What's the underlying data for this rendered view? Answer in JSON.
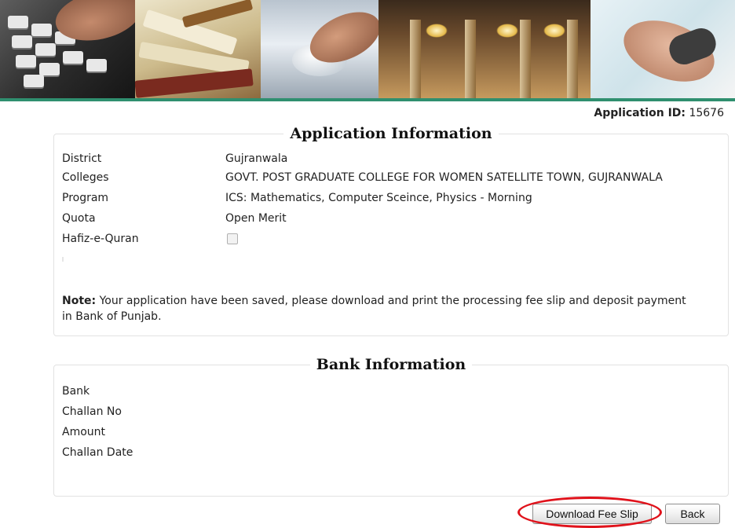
{
  "header": {
    "app_id_label": "Application ID:",
    "app_id_value": "15676"
  },
  "application_info": {
    "title": "Application Information",
    "fields": [
      {
        "label": "District",
        "value": "Gujranwala"
      },
      {
        "label": "Colleges",
        "value": "GOVT. POST GRADUATE COLLEGE FOR WOMEN SATELLITE TOWN, GUJRANWALA"
      },
      {
        "label": "Program",
        "value": "ICS: Mathematics, Computer Sceince, Physics - Morning"
      },
      {
        "label": "Quota",
        "value": "Open Merit"
      },
      {
        "label": "Hafiz-e-Quran",
        "checked": false
      }
    ],
    "note_label": "Note:",
    "note_text": " Your application have been saved, please download and print the processing fee slip and deposit payment in Bank of Punjab."
  },
  "bank_info": {
    "title": "Bank Information",
    "fields": [
      {
        "label": "Bank",
        "value": ""
      },
      {
        "label": "Challan No",
        "value": ""
      },
      {
        "label": "Amount",
        "value": ""
      },
      {
        "label": "Challan Date",
        "value": ""
      }
    ]
  },
  "actions": {
    "download_label": "Download Fee Slip",
    "back_label": "Back",
    "highlight_color": "#e0121b"
  },
  "colors": {
    "banner_bar": "#2f8f6f",
    "border": "#e2e2e2"
  }
}
